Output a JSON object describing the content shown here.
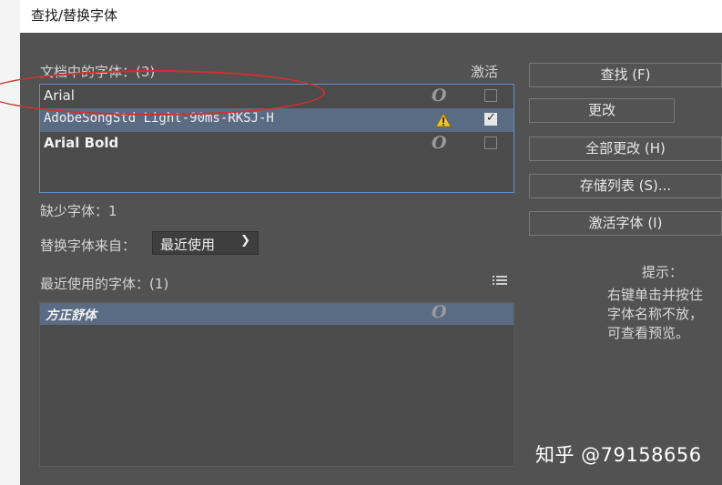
{
  "window": {
    "title": "查找/替换字体"
  },
  "doc_fonts": {
    "header": "文档中的字体：(3)",
    "activate_header": "激活",
    "rows": [
      {
        "name": "Arial",
        "type_icon": "opentype-icon",
        "checked": false,
        "selected": false
      },
      {
        "name": "AdobeSongStd Light-90ms-RKSJ-H",
        "type_icon": "warning-icon",
        "checked": true,
        "selected": true
      },
      {
        "name": "Arial Bold",
        "type_icon": "opentype-icon",
        "checked": false,
        "selected": false
      }
    ]
  },
  "missing_fonts": "缺少字体：1",
  "replace_from": {
    "label": "替换字体来自：",
    "selected": "最近使用"
  },
  "recent_fonts": {
    "header": "最近使用的字体：(1)",
    "rows": [
      {
        "name": "方正舒体",
        "type_icon": "opentype-icon"
      }
    ]
  },
  "otype_glyph": "O",
  "buttons": {
    "find": "查找 (F)",
    "change": "更改",
    "change_all": "全部更改 (H)",
    "save_list": "存储列表 (S)...",
    "activate_font": "激活字体 (I)"
  },
  "hint": {
    "title": "提示：",
    "line1": "右键单击并按住",
    "line2": "字体名称不放，",
    "line3": "可查看预览。"
  },
  "watermark": "知乎 @79158656",
  "colors": {
    "dialog_bg": "#525252",
    "selection": "#5a6c84",
    "focus_border": "#5f8fd0",
    "annotation_red": "#d0312d"
  }
}
